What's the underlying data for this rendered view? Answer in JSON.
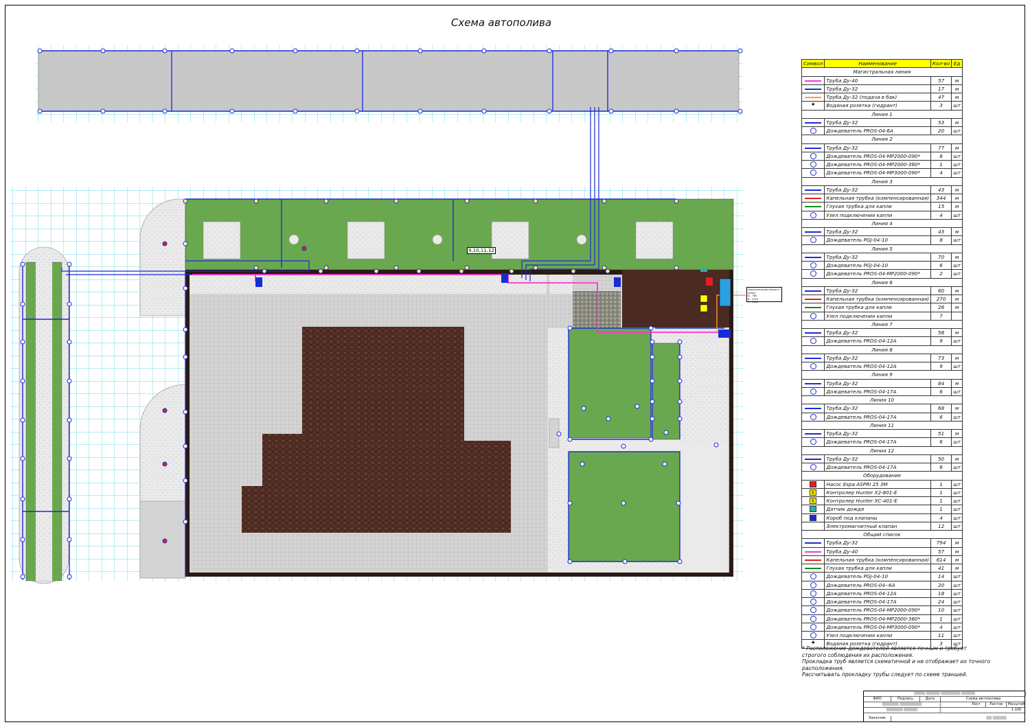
{
  "sheet_title": "Схема автополива",
  "valve_group_label": "9,10,11,12",
  "pump_callout": [
    "Накопительная емкость 2000л",
    "D - 760",
    "В - 1510",
    "Н - 1610"
  ],
  "colors": {
    "main_pipe_40": "#ff33cc",
    "pipe_32": "#1a2bd6",
    "pipe_32_house": "#ff9933",
    "drip_tube": "#e02020",
    "blind_drip_tube": "#1a8a1a",
    "lawn": "#6aa84f",
    "paving_grey": "#c8c8c8",
    "dark_paving": "#4a2a22",
    "grid": "#30d0e0",
    "header_yellow": "#ffff00"
  },
  "legend": {
    "headers": [
      "Символ",
      "Наименование",
      "Кол-во",
      "Ед"
    ],
    "rows": [
      {
        "type": "section",
        "name": "Магистральная линия"
      },
      {
        "sym": "line",
        "color": "#ff33cc",
        "name": "Труба Ду-40",
        "qty": "57",
        "unit": "м"
      },
      {
        "sym": "line",
        "color": "#1a2bd6",
        "name": "Труба Ду-32",
        "qty": "17",
        "unit": "м"
      },
      {
        "sym": "line",
        "color": "#ff9933",
        "name": "Труба Ду-32 (подача в бак)",
        "qty": "47",
        "unit": "м"
      },
      {
        "sym": "hyd",
        "name": "Водяная розетка (гидрант)",
        "qty": "3",
        "unit": "шт"
      },
      {
        "type": "section",
        "name": "Линия 1"
      },
      {
        "sym": "line",
        "color": "#1a2bd6",
        "name": "Труба Ду-32",
        "qty": "53",
        "unit": "м"
      },
      {
        "sym": "circ",
        "name": "Дождеватель PROS-04-6A",
        "qty": "20",
        "unit": "шт"
      },
      {
        "type": "section",
        "name": "Линия 2"
      },
      {
        "sym": "line",
        "color": "#1a2bd6",
        "name": "Труба Ду-32",
        "qty": "77",
        "unit": "м"
      },
      {
        "sym": "circ",
        "name": "Дождеватель PROS-04-MP2000-090*",
        "qty": "8",
        "unit": "шт"
      },
      {
        "sym": "circ",
        "name": "Дождеватель PROS-04-MP2000-360*",
        "qty": "1",
        "unit": "шт"
      },
      {
        "sym": "circ",
        "name": "Дождеватель PROS-04-MP3000-090*",
        "qty": "4",
        "unit": "шт"
      },
      {
        "type": "section",
        "name": "Линия 3"
      },
      {
        "sym": "line",
        "color": "#1a2bd6",
        "name": "Труба Ду-32",
        "qty": "43",
        "unit": "м"
      },
      {
        "sym": "line",
        "color": "#e02020",
        "name": "Капельная трубка (компенсированная)",
        "qty": "344",
        "unit": "м"
      },
      {
        "sym": "line",
        "color": "#1a8a1a",
        "name": "Глухая трубка для капли",
        "qty": "15",
        "unit": "м"
      },
      {
        "sym": "circ",
        "name": "Узел подключения капли",
        "qty": "4",
        "unit": "шт"
      },
      {
        "type": "section",
        "name": "Линия 4"
      },
      {
        "sym": "line",
        "color": "#1a2bd6",
        "name": "Труба Ду-32",
        "qty": "43",
        "unit": "м"
      },
      {
        "sym": "circ",
        "name": "Дождеватель PGJ-04-10",
        "qty": "8",
        "unit": "шт"
      },
      {
        "type": "section",
        "name": "Линия 5"
      },
      {
        "sym": "line",
        "color": "#1a2bd6",
        "name": "Труба Ду-32",
        "qty": "70",
        "unit": "м"
      },
      {
        "sym": "circ",
        "name": "Дождеватель PGJ-04-10",
        "qty": "6",
        "unit": "шт"
      },
      {
        "sym": "circ",
        "name": "Дождеватель PROS-04-MP2000-090*",
        "qty": "2",
        "unit": "шт"
      },
      {
        "type": "section",
        "name": "Линия 6"
      },
      {
        "sym": "line",
        "color": "#1a2bd6",
        "name": "Труба Ду-32",
        "qty": "60",
        "unit": "м"
      },
      {
        "sym": "line",
        "color": "#e02020",
        "name": "Капельная трубка (компенсированная)",
        "qty": "270",
        "unit": "м"
      },
      {
        "sym": "line",
        "color": "#1a8a1a",
        "name": "Глухая трубка для капли",
        "qty": "26",
        "unit": "м"
      },
      {
        "sym": "circ",
        "name": "Узел подключения капли",
        "qty": "7",
        "unit": ""
      },
      {
        "type": "section",
        "name": "Линия 7"
      },
      {
        "sym": "line",
        "color": "#1a2bd6",
        "name": "Труба Ду-32",
        "qty": "58",
        "unit": "м"
      },
      {
        "sym": "circ",
        "name": "Дождеватель PROS-04-12A",
        "qty": "9",
        "unit": "шт"
      },
      {
        "type": "section",
        "name": "Линия 8"
      },
      {
        "sym": "line",
        "color": "#1a2bd6",
        "name": "Труба Ду-32",
        "qty": "73",
        "unit": "м"
      },
      {
        "sym": "circ",
        "name": "Дождеватель PROS-04-12A",
        "qty": "9",
        "unit": "шт"
      },
      {
        "type": "section",
        "name": "Линия 9"
      },
      {
        "sym": "line",
        "color": "#1a2bd6",
        "name": "Труба Ду-32",
        "qty": "84",
        "unit": "м"
      },
      {
        "sym": "circ",
        "name": "Дождеватель PROS-04-17A",
        "qty": "6",
        "unit": "шт"
      },
      {
        "type": "section",
        "name": "Линия 10"
      },
      {
        "sym": "line",
        "color": "#1a2bd6",
        "name": "Труба Ду-32",
        "qty": "68",
        "unit": "м"
      },
      {
        "sym": "circ",
        "name": "Дождеватель PROS-04-17A",
        "qty": "6",
        "unit": "шт"
      },
      {
        "type": "section",
        "name": "Линия 11"
      },
      {
        "sym": "line",
        "color": "#1a2bd6",
        "name": "Труба Ду-32",
        "qty": "51",
        "unit": "м"
      },
      {
        "sym": "circ",
        "name": "Дождеватель PROS-04-17A",
        "qty": "6",
        "unit": "шт"
      },
      {
        "type": "section",
        "name": "Линия 12"
      },
      {
        "sym": "line",
        "color": "#1a2bd6",
        "name": "Труба Ду-32",
        "qty": "50",
        "unit": "м"
      },
      {
        "sym": "circ",
        "name": "Дождеватель PROS-04-17A",
        "qty": "6",
        "unit": "шт"
      },
      {
        "type": "section",
        "name": "Оборудование"
      },
      {
        "sym": "sq",
        "color": "#e02020",
        "label": "",
        "name": "Насос Espa ASPRI 25 3M",
        "qty": "1",
        "unit": "шт"
      },
      {
        "sym": "sq",
        "color": "#ffff00",
        "label": "K",
        "name": "Контролер Hunter X2-801-E",
        "qty": "1",
        "unit": "шт"
      },
      {
        "sym": "sq",
        "color": "#ffff00",
        "label": "K",
        "name": "Контролер Hunter XC-401-E",
        "qty": "1",
        "unit": "шт"
      },
      {
        "sym": "sq",
        "color": "#2ab0a0",
        "label": "",
        "name": "Датчик дождя",
        "qty": "1",
        "unit": "шт"
      },
      {
        "sym": "sq",
        "color": "#1a2bd6",
        "label": "",
        "name": "Короб под клапаны",
        "qty": "4",
        "unit": "шт"
      },
      {
        "sym": "none",
        "name": "Электромагнитный клапан",
        "qty": "12",
        "unit": "шт"
      },
      {
        "type": "section",
        "name": "Общий список"
      },
      {
        "sym": "line",
        "color": "#1a2bd6",
        "name": "Труба Ду-32",
        "qty": "794",
        "unit": "м"
      },
      {
        "sym": "line",
        "color": "#ff33cc",
        "name": "Труба Ду-40",
        "qty": "57",
        "unit": "м"
      },
      {
        "sym": "line",
        "color": "#e02020",
        "name": "Капельная трубка (компенсированная)",
        "qty": "614",
        "unit": "м"
      },
      {
        "sym": "line",
        "color": "#1a8a1a",
        "name": "Глухая трубка для капли",
        "qty": "41",
        "unit": "м"
      },
      {
        "sym": "circ",
        "name": "Дождеватель PGJ-04-10",
        "qty": "14",
        "unit": "шт"
      },
      {
        "sym": "circ",
        "name": "Дождеватель PROS-04--6A",
        "qty": "20",
        "unit": "шт"
      },
      {
        "sym": "circ",
        "name": "Дождеватель PROS-04-12A",
        "qty": "18",
        "unit": "шт"
      },
      {
        "sym": "circ",
        "name": "Дождеватель PROS-04-17A",
        "qty": "24",
        "unit": "шт"
      },
      {
        "sym": "circ",
        "name": "Дождеватель PROS-04-MP2000-090*",
        "qty": "10",
        "unit": "шт"
      },
      {
        "sym": "circ",
        "name": "Дождеватель PROS-04-MP2000-360*",
        "qty": "1",
        "unit": "шт"
      },
      {
        "sym": "circ",
        "name": "Дождеватель PROS-04-MP3000-090*",
        "qty": "4",
        "unit": "шт"
      },
      {
        "sym": "circ",
        "name": "Узел подключения капли",
        "qty": "11",
        "unit": "шт"
      },
      {
        "sym": "hyd",
        "name": "Водяная розетка (гидрант)",
        "qty": "3",
        "unit": "шт"
      }
    ]
  },
  "notes": [
    "* Расположение дождевателей является точным и требует",
    "строгого соблюдения их расположения.",
    "Прокладка труб является схематичной и не отображает их точного расположения.",
    "Рассчитывать прокладку трубы следует по схеме траншей."
  ],
  "title_block": {
    "headers": [
      "ФИО",
      "Подпись",
      "Дата"
    ],
    "project": "Схема автополива",
    "sheet_headers": [
      "Лист",
      "Листов",
      "Масштаб"
    ],
    "scale": "1:100",
    "customer": "Заказчик"
  }
}
